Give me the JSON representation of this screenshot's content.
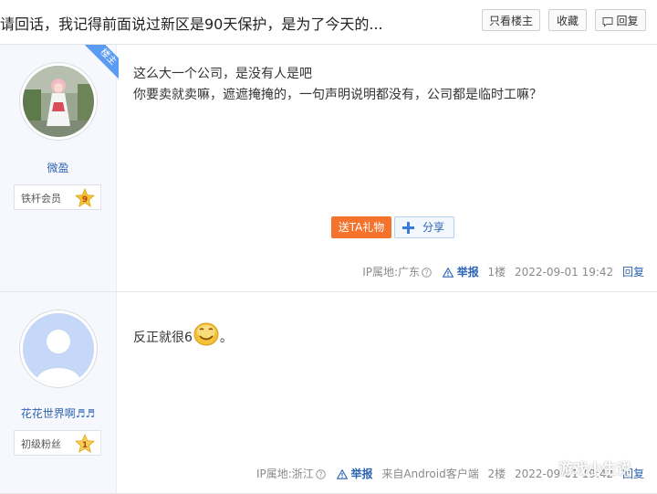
{
  "header": {
    "title": "请回话，我记得前面说过新区是90天保护，是为了今天的...",
    "buttons": {
      "author_only": "只看楼主",
      "favorite": "收藏",
      "reply": "回复"
    }
  },
  "posts": [
    {
      "author": "微盈",
      "badge_label": "铁杆会员",
      "level": "9",
      "op_ribbon": "楼主",
      "content_lines": [
        "这么大一个公司，是没有人是吧",
        "你要卖就卖嘛，遮遮掩掩的，一句声明说明都没有，公司都是临时工嘛？"
      ],
      "gift_label": "送TA礼物",
      "share_label": "分享",
      "ip": "IP属地:广东",
      "report": "举报",
      "floor": "1楼",
      "time": "2022-09-01 19:42",
      "reply": "回复"
    },
    {
      "author": "花花世界啊♬♬",
      "badge_label": "初级粉丝",
      "level": "1",
      "content_text": "反正就很6",
      "content_after": "。",
      "emoji": "smiling-face-emoji",
      "ip": "IP属地:浙江",
      "report": "举报",
      "client": "来自Android客户端",
      "floor": "2楼",
      "time": "2022-09-01 19:42",
      "reply": "回复"
    }
  ],
  "watermark": "游戏小生说",
  "colors": {
    "link": "#2d64b3",
    "gift": "#f5732d",
    "ribbon": "#5b9cf2",
    "sidebar": "#f6f8fd"
  }
}
